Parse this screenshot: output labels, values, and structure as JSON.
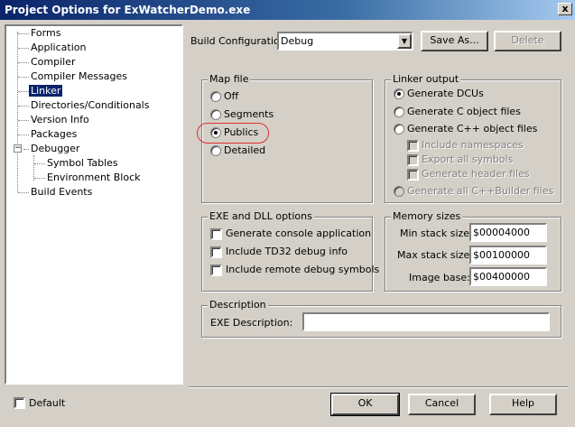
{
  "window": {
    "title": "Project Options for ExWatcherDemo.exe",
    "close_label": "x"
  },
  "tree": {
    "items": [
      {
        "label": "Forms"
      },
      {
        "label": "Application"
      },
      {
        "label": "Compiler"
      },
      {
        "label": "Compiler Messages"
      },
      {
        "label": "Linker",
        "selected": true
      },
      {
        "label": "Directories/Conditionals"
      },
      {
        "label": "Version Info"
      },
      {
        "label": "Packages"
      },
      {
        "label": "Debugger",
        "expanded": true
      },
      {
        "label": "Symbol Tables"
      },
      {
        "label": "Environment Block"
      },
      {
        "label": "Build Events"
      }
    ],
    "expander_glyph": "−"
  },
  "build_config": {
    "label": "Build Configuration",
    "value": "Debug",
    "save_as": "Save As...",
    "delete": "Delete"
  },
  "map_file": {
    "legend": "Map file",
    "options": [
      "Off",
      "Segments",
      "Publics",
      "Detailed"
    ],
    "selected": "Publics"
  },
  "linker_output": {
    "legend": "Linker output",
    "generate_dcus": "Generate DCUs",
    "generate_c_obj": "Generate C object files",
    "generate_cpp_obj": "Generate C++ object files",
    "include_namespaces": "Include namespaces",
    "export_all_symbols": "Export all symbols",
    "generate_header_files": "Generate header files",
    "generate_all_cppbuilder": "Generate all C++Builder files"
  },
  "exe_dll": {
    "legend": "EXE and DLL options",
    "console": "Generate console application",
    "td32": "Include TD32 debug info",
    "remote": "Include remote debug symbols"
  },
  "memory": {
    "legend": "Memory sizes",
    "min_stack_label": "Min stack size:",
    "min_stack_value": "$00004000",
    "max_stack_label": "Max stack size:",
    "max_stack_value": "$00100000",
    "image_base_label": "Image base:",
    "image_base_value": "$00400000"
  },
  "description": {
    "legend": "Description",
    "exe_desc_label": "EXE Description:",
    "exe_desc_value": ""
  },
  "footer": {
    "default_label": "Default",
    "ok": "OK",
    "cancel": "Cancel",
    "help": "Help"
  }
}
